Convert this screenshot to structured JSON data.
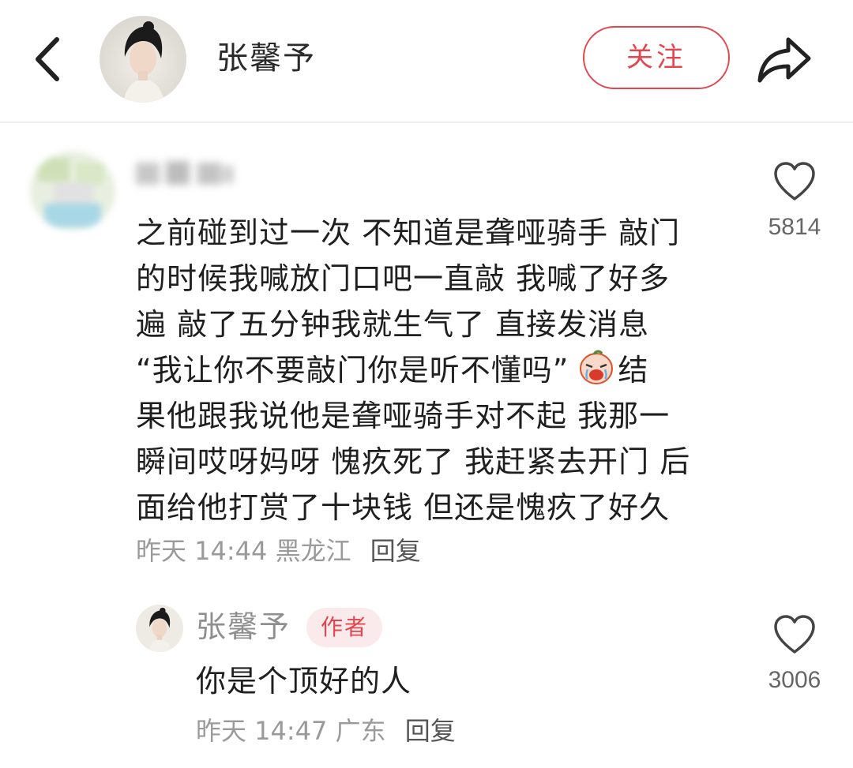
{
  "header": {
    "author_name": "张馨予",
    "follow_label": "关注",
    "icons": [
      "back-icon",
      "avatar",
      "share-icon"
    ]
  },
  "comment": {
    "username_blurred": true,
    "lines": [
      "之前碰到过一次 不知道是聋哑骑手 敲门",
      "的时候我喊放门口吧一直敲 我喊了好多",
      "遍 敲了五分钟我就生气了 直接发消息",
      "“我让你不要敲门你是听不懂吗”",
      "结",
      "果他跟我说他是聋哑骑手对不起 我那一",
      "瞬间哎呀妈呀 愧疚死了 我赶紧去开门 后",
      "面给他打赏了十块钱 但还是愧疚了好久"
    ],
    "emoji": "crying-face-emoji",
    "time": "昨天 14:44",
    "location": "黑龙江",
    "reply_label": "回复",
    "like_count": "5814"
  },
  "reply": {
    "username": "张馨予",
    "badge": "作者",
    "text": "你是个顶好的人",
    "time": "昨天 14:47",
    "location": "广东",
    "reply_label": "回复",
    "like_count": "3006"
  },
  "colors": {
    "accent": "#e3464f",
    "badge_bg": "#fbeaec",
    "meta_text": "#9a9a9a"
  }
}
